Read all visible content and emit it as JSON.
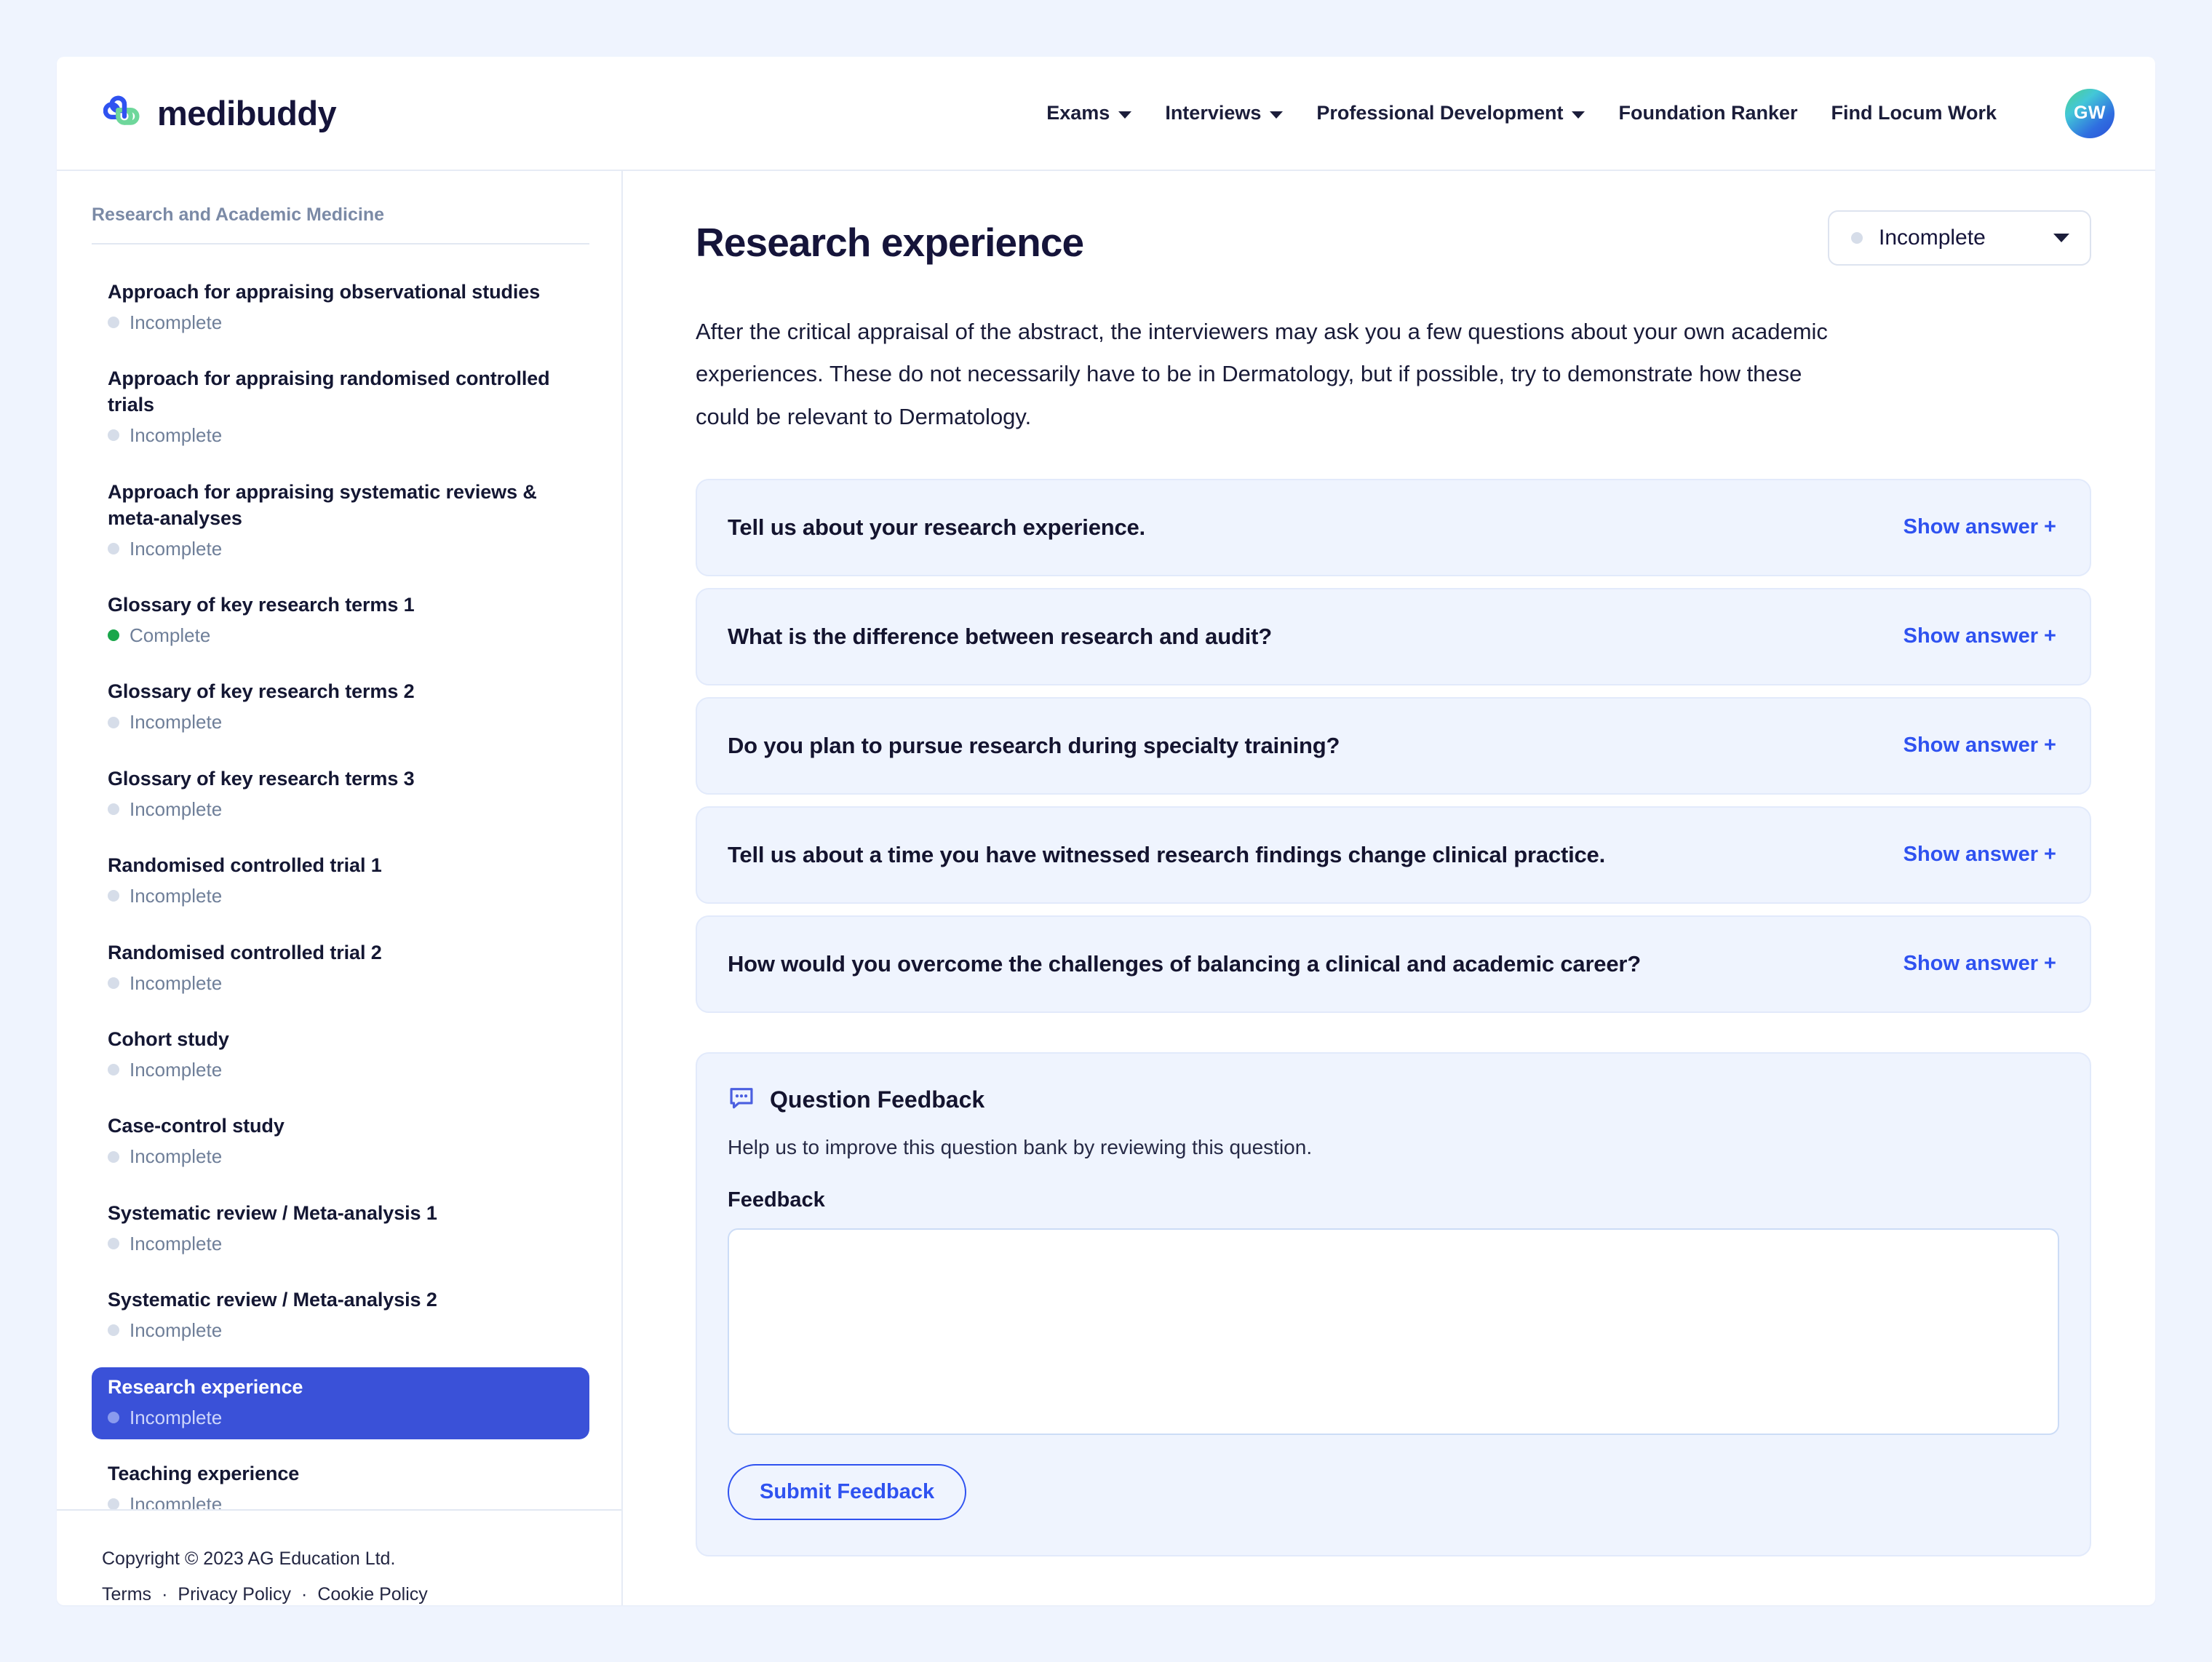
{
  "brand": {
    "name": "medibuddy",
    "logo_icon": "medibuddy-cross-logo"
  },
  "nav": {
    "items": [
      {
        "label": "Exams",
        "has_dropdown": true
      },
      {
        "label": "Interviews",
        "has_dropdown": true
      },
      {
        "label": "Professional Development",
        "has_dropdown": true
      },
      {
        "label": "Foundation Ranker",
        "has_dropdown": false
      },
      {
        "label": "Find Locum Work",
        "has_dropdown": false
      }
    ],
    "avatar_initials": "GW"
  },
  "sidebar": {
    "heading": "Research and Academic Medicine",
    "items": [
      {
        "title": "Approach for appraising observational studies",
        "status": "Incomplete",
        "state": "incomplete",
        "active": false
      },
      {
        "title": "Approach for appraising randomised controlled trials",
        "status": "Incomplete",
        "state": "incomplete",
        "active": false
      },
      {
        "title": "Approach for appraising systematic reviews & meta-analyses",
        "status": "Incomplete",
        "state": "incomplete",
        "active": false
      },
      {
        "title": "Glossary of key research terms 1",
        "status": "Complete",
        "state": "complete",
        "active": false
      },
      {
        "title": "Glossary of key research terms 2",
        "status": "Incomplete",
        "state": "incomplete",
        "active": false
      },
      {
        "title": "Glossary of key research terms 3",
        "status": "Incomplete",
        "state": "incomplete",
        "active": false
      },
      {
        "title": "Randomised controlled trial 1",
        "status": "Incomplete",
        "state": "incomplete",
        "active": false
      },
      {
        "title": "Randomised controlled trial 2",
        "status": "Incomplete",
        "state": "incomplete",
        "active": false
      },
      {
        "title": "Cohort study",
        "status": "Incomplete",
        "state": "incomplete",
        "active": false
      },
      {
        "title": "Case-control study",
        "status": "Incomplete",
        "state": "incomplete",
        "active": false
      },
      {
        "title": "Systematic review / Meta-analysis 1",
        "status": "Incomplete",
        "state": "incomplete",
        "active": false
      },
      {
        "title": "Systematic review / Meta-analysis 2",
        "status": "Incomplete",
        "state": "incomplete",
        "active": false
      },
      {
        "title": "Research experience",
        "status": "Incomplete",
        "state": "incomplete",
        "active": true
      },
      {
        "title": "Teaching experience",
        "status": "Incomplete",
        "state": "incomplete",
        "active": false
      }
    ]
  },
  "footer": {
    "copyright": "Copyright © 2023 AG Education Ltd.",
    "links": [
      "Terms",
      "Privacy Policy",
      "Cookie Policy"
    ],
    "separator": "·"
  },
  "main": {
    "title": "Research experience",
    "status_dropdown": {
      "value": "Incomplete",
      "state": "incomplete"
    },
    "intro": "After the critical appraisal of the abstract, the interviewers may ask you a few questions about your own academic experiences. These do not necessarily have to be in Dermatology, but if possible, try to demonstrate how these could be relevant to Dermatology.",
    "show_answer_label": "Show answer +",
    "questions": [
      {
        "text": "Tell us about your research experience."
      },
      {
        "text": "What is the difference between research and audit?"
      },
      {
        "text": "Do you plan to pursue research during specialty training?"
      },
      {
        "text": "Tell us about a time you have witnessed research findings change clinical practice."
      },
      {
        "text": "How would you overcome the challenges of balancing a clinical and academic career?"
      }
    ]
  },
  "feedback": {
    "icon": "chat-bubble-dots-icon",
    "title": "Question Feedback",
    "subtitle": "Help us to improve this question bank by reviewing this question.",
    "field_label": "Feedback",
    "textarea_value": "",
    "textarea_placeholder": "",
    "submit_label": "Submit Feedback"
  },
  "colors": {
    "page_background": "#eff4fe",
    "accent_blue": "#2f52f0",
    "active_nav_blue": "#3a51d8",
    "complete_green": "#1aa64b",
    "incomplete_grey": "#d6dde9",
    "text_dark": "#15143a"
  }
}
